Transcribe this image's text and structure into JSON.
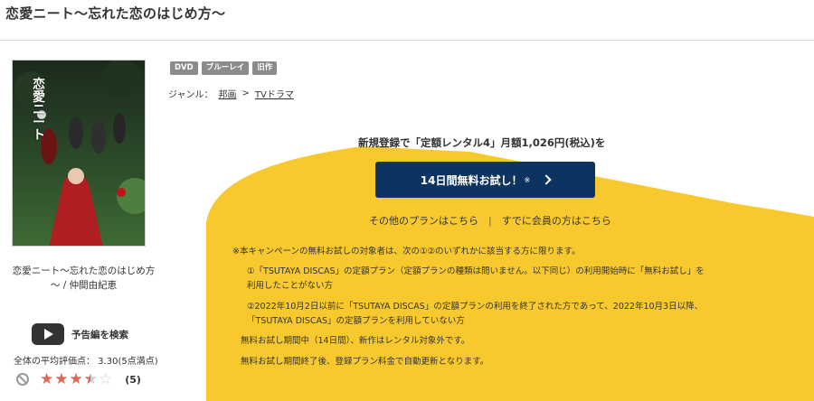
{
  "page": {
    "title": "恋愛ニート～忘れた恋のはじめ方～"
  },
  "work": {
    "title_line1": "恋愛ニート～忘れた恋のはじめ方",
    "title_line2": "～ / 仲間由紀恵",
    "cover_title_text": "恋愛ニート",
    "trailer_label": "予告編を検索",
    "avg_rating_label": "全体の平均評価点： 3.30(5点満点)",
    "rating_value": 3.3,
    "rating_max": 5,
    "review_count": "(5)"
  },
  "badges": [
    "DVD",
    "ブルーレイ",
    "旧作"
  ],
  "genre": {
    "label": "ジャンル：",
    "items": [
      "邦画",
      "TVドラマ"
    ],
    "separator": ">"
  },
  "campaign": {
    "headline": "新規登録で「定額レンタル4」月額1,026円(税込)を",
    "button_label": "14日間無料お試し！",
    "button_mark": "※",
    "other_plans": "その他のプランはこちら",
    "separator": "|",
    "member_link": "すでに会員の方はこちら",
    "notes": {
      "intro": "※本キャンペーンの無料お試しの対象者は、次の①②のいずれかに該当する方に限ります。",
      "item1_line1": "①「TSUTAYA DISCAS」の定額プラン（定額プランの種類は問いません。以下同じ）の利用開始時に「無料お試し」を",
      "item1_line2": "利用したことがない方",
      "item2_line1": "②2022年10月2日以前に「TSUTAYA DISCAS」の定額プランの利用を終了された方であって、2022年10月3日以降、",
      "item2_line2": "「TSUTAYA DISCAS」の定額プランを利用していない方",
      "line3": "無料お試し期間中（14日間）、新作はレンタル対象外です。",
      "line4": "無料お試し期間終了後、登録プラン料金で自動更新となります。"
    }
  },
  "colors": {
    "accent_yellow": "#f7c92f",
    "button_navy": "#0c3461",
    "star_red": "#e0645a"
  }
}
